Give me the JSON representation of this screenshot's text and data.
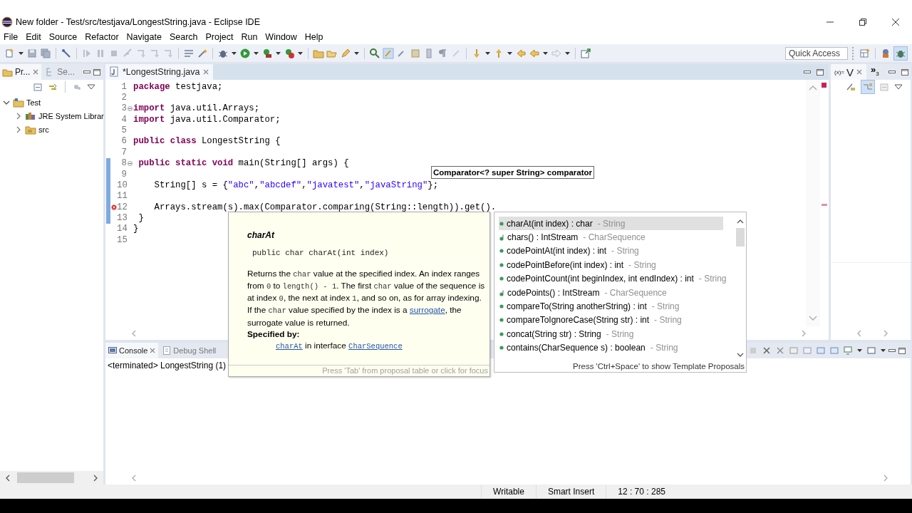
{
  "window": {
    "title": "New folder - Test/src/testjava/LongestString.java - Eclipse IDE"
  },
  "menu": [
    {
      "label": "File"
    },
    {
      "label": "Edit"
    },
    {
      "label": "Source"
    },
    {
      "label": "Refactor"
    },
    {
      "label": "Navigate"
    },
    {
      "label": "Search"
    },
    {
      "label": "Project"
    },
    {
      "label": "Run"
    },
    {
      "label": "Window"
    },
    {
      "label": "Help"
    }
  ],
  "quick_access": {
    "placeholder": "Quick Access"
  },
  "left_panel": {
    "tabs": [
      {
        "label": "Pr...",
        "selected": true
      },
      {
        "label": "Se...",
        "selected": false
      }
    ],
    "tree": [
      {
        "label": "Test",
        "kind": "project",
        "expanded": true,
        "children": [
          {
            "label": "JRE System Librar",
            "kind": "library",
            "expanded": false
          },
          {
            "label": "src",
            "kind": "source",
            "expanded": false
          }
        ]
      }
    ]
  },
  "editor": {
    "tab": {
      "label": "*LongestString.java"
    },
    "lines": [
      {
        "number": "1",
        "fold": false,
        "changed": false,
        "error": false,
        "tokens": [
          {
            "kind": "keyword",
            "text": "package"
          },
          {
            "kind": "plain",
            "text": " testjava;"
          }
        ]
      },
      {
        "number": "2",
        "fold": false,
        "changed": false,
        "error": false
      },
      {
        "number": "3",
        "fold": true,
        "changed": false,
        "error": false,
        "tokens": [
          {
            "kind": "keyword",
            "text": "import"
          },
          {
            "kind": "plain",
            "text": " java.util.Arrays;"
          }
        ]
      },
      {
        "number": "4",
        "fold": false,
        "changed": false,
        "error": false,
        "tokens": [
          {
            "kind": "keyword",
            "text": "import"
          },
          {
            "kind": "plain",
            "text": " java.util.Comparator;"
          }
        ]
      },
      {
        "number": "5",
        "fold": false,
        "changed": false,
        "error": false
      },
      {
        "number": "6",
        "fold": false,
        "changed": false,
        "error": false,
        "tokens": [
          {
            "kind": "keyword",
            "text": "public"
          },
          {
            "kind": "keyword",
            "text": " class"
          },
          {
            "kind": "plain",
            "text": " LongestString {"
          }
        ]
      },
      {
        "number": "7",
        "fold": false,
        "changed": false,
        "error": false
      },
      {
        "number": "8",
        "fold": true,
        "changed": true,
        "error": false,
        "tokens": [
          {
            "kind": "keyword",
            "text": " public"
          },
          {
            "kind": "keyword",
            "text": " static"
          },
          {
            "kind": "keyword",
            "text": " void"
          },
          {
            "kind": "plain",
            "text": " main(String[] args) {"
          }
        ]
      },
      {
        "number": "9",
        "fold": false,
        "changed": true,
        "error": false
      },
      {
        "number": "10",
        "fold": false,
        "changed": true,
        "error": false,
        "tokens": [
          {
            "kind": "plain",
            "text": "    String[] s = {"
          },
          {
            "kind": "string",
            "text": "\"abc\""
          },
          {
            "kind": "plain",
            "text": ","
          },
          {
            "kind": "string",
            "text": "\"abcdef\""
          },
          {
            "kind": "plain",
            "text": ","
          },
          {
            "kind": "string",
            "text": "\"javatest\""
          },
          {
            "kind": "plain",
            "text": ","
          },
          {
            "kind": "string",
            "text": "\"javaString\""
          },
          {
            "kind": "plain",
            "text": "};"
          }
        ]
      },
      {
        "number": "11",
        "fold": false,
        "changed": true,
        "error": false
      },
      {
        "number": "12",
        "fold": false,
        "changed": true,
        "error": true,
        "tokens": [
          {
            "kind": "plain",
            "text": "    Arrays.stream(s).max(Comparator.comparing(String::length)).get()."
          }
        ]
      },
      {
        "number": "13",
        "fold": false,
        "changed": true,
        "error": false,
        "tokens": [
          {
            "kind": "plain",
            "text": " }"
          }
        ]
      },
      {
        "number": "14",
        "fold": false,
        "changed": false,
        "error": false,
        "tokens": [
          {
            "kind": "plain",
            "text": "}"
          }
        ]
      },
      {
        "number": "15",
        "fold": false,
        "changed": false,
        "error": false
      }
    ],
    "parameter_hint": "Comparator<? super String> comparator"
  },
  "right_panel": {
    "tab": {
      "icon_text": "(x)=",
      "label": "V"
    },
    "overflow": {
      "chevron": "»",
      "count": "3"
    }
  },
  "javadoc": {
    "title": "charAt",
    "signature": "public char charAt(int index)",
    "paragraphs": [
      [
        {
          "kind": "text",
          "text": "Returns the "
        },
        {
          "kind": "code",
          "text": "char"
        },
        {
          "kind": "text",
          "text": " value at the specified index. An index ranges from "
        },
        {
          "kind": "code",
          "text": "0"
        },
        {
          "kind": "text",
          "text": " to "
        },
        {
          "kind": "code",
          "text": "length() - 1"
        },
        {
          "kind": "text",
          "text": ". The first "
        },
        {
          "kind": "code",
          "text": "char"
        },
        {
          "kind": "text",
          "text": " value of the sequence is at index "
        },
        {
          "kind": "code",
          "text": "0"
        },
        {
          "kind": "text",
          "text": ", the next at index "
        },
        {
          "kind": "code",
          "text": "1"
        },
        {
          "kind": "text",
          "text": ", and so on, as for array indexing."
        }
      ],
      [
        {
          "kind": "text",
          "text": "If the "
        },
        {
          "kind": "code",
          "text": "char"
        },
        {
          "kind": "text",
          "text": " value specified by the index is a "
        },
        {
          "kind": "link",
          "text": "surrogate"
        },
        {
          "kind": "text",
          "text": ", the surrogate value is returned."
        }
      ]
    ],
    "specified_by": {
      "heading": "Specified by:",
      "line": [
        {
          "kind": "code-link",
          "text": "charAt"
        },
        {
          "kind": "text",
          "text": " in interface "
        },
        {
          "kind": "code-link",
          "text": "CharSequence"
        }
      ]
    },
    "footer": "Press 'Tab' from proposal table or click for focus"
  },
  "proposals": {
    "items": [
      {
        "signature": "charAt(int index) : char",
        "owner": "- String",
        "kind": "method",
        "selected": true
      },
      {
        "signature": "chars() : IntStream",
        "owner": "- CharSequence",
        "kind": "default",
        "selected": false
      },
      {
        "signature": "codePointAt(int index) : int",
        "owner": "- String",
        "kind": "method",
        "selected": false
      },
      {
        "signature": "codePointBefore(int index) : int",
        "owner": "- String",
        "kind": "method",
        "selected": false
      },
      {
        "signature": "codePointCount(int beginIndex, int endIndex) : int",
        "owner": "- String",
        "kind": "method",
        "selected": false
      },
      {
        "signature": "codePoints() : IntStream",
        "owner": "- CharSequence",
        "kind": "default",
        "selected": false
      },
      {
        "signature": "compareTo(String anotherString) : int",
        "owner": "- String",
        "kind": "method",
        "selected": false
      },
      {
        "signature": "compareToIgnoreCase(String str) : int",
        "owner": "- String",
        "kind": "method",
        "selected": false
      },
      {
        "signature": "concat(String str) : String",
        "owner": "- String",
        "kind": "method",
        "selected": false
      },
      {
        "signature": "contains(CharSequence s) : boolean",
        "owner": "- String",
        "kind": "method",
        "selected": false
      }
    ],
    "footer": "Press 'Ctrl+Space' to show Template Proposals"
  },
  "console": {
    "tabs": [
      {
        "label": "Console",
        "selected": true
      },
      {
        "label": "Debug Shell",
        "selected": false
      }
    ],
    "status": "<terminated> LongestString (1)"
  },
  "status_bar": {
    "items": [
      {
        "text": "Writable"
      },
      {
        "text": "Smart Insert"
      },
      {
        "text": "12 : 70 : 285"
      }
    ]
  }
}
